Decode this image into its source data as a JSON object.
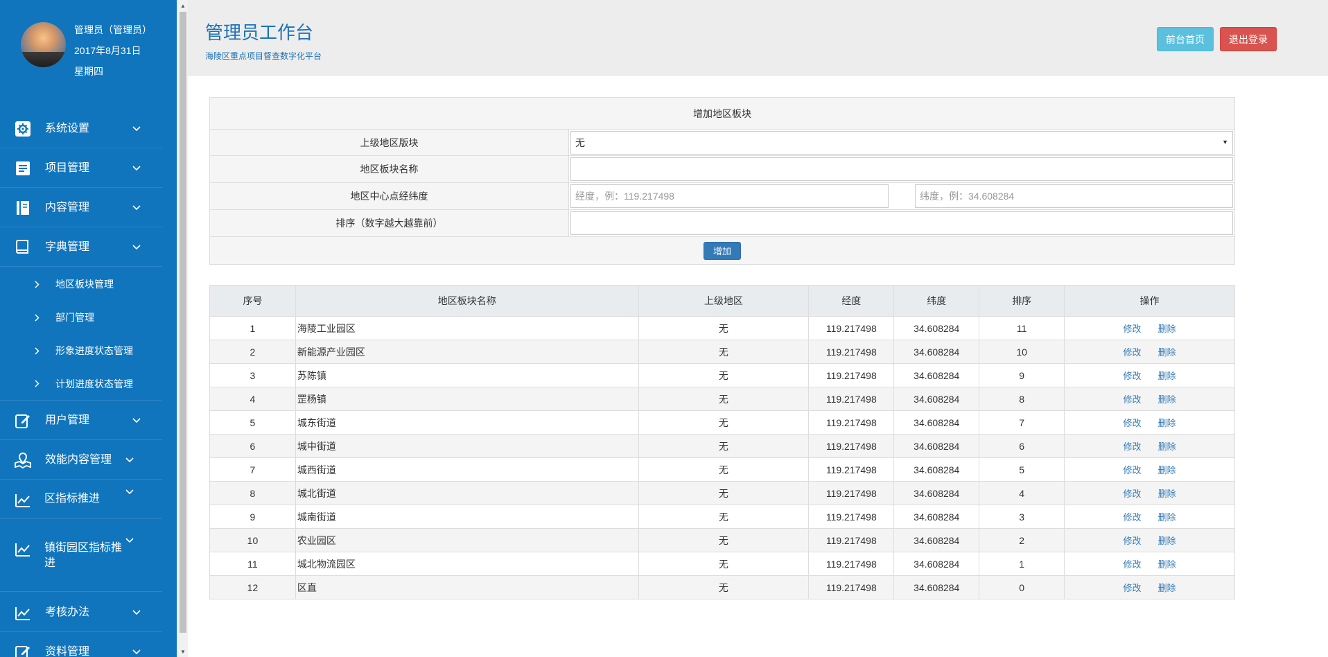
{
  "profile": {
    "name": "管理员（管理员）",
    "date": "2017年8月31日",
    "weekday": "星期四"
  },
  "nav": {
    "system": "系统设置",
    "project": "项目管理",
    "content": "内容管理",
    "dict": "字典管理",
    "dict_sub": [
      "地区板块管理",
      "部门管理",
      "形象进度状态管理",
      "计划进度状态管理"
    ],
    "user": "用户管理",
    "efficiency": "效能内容管理",
    "district": "区指标推进",
    "town": "镇街园区指标推进",
    "assess": "考核办法",
    "data": "资料管理"
  },
  "header": {
    "title": "管理员工作台",
    "subtitle": "海陵区重点项目督查数字化平台",
    "btn_front": "前台首页",
    "btn_logout": "退出登录"
  },
  "form": {
    "heading": "增加地区板块",
    "parent_label": "上级地区版块",
    "parent_value": "无",
    "name_label": "地区板块名称",
    "coord_label": "地区中心点经纬度",
    "lng_placeholder": "经度，例：119.217498",
    "lat_placeholder": "纬度，例：34.608284",
    "sort_label": "排序（数字越大越靠前）",
    "add_btn": "增加"
  },
  "table": {
    "headers": [
      "序号",
      "地区板块名称",
      "上级地区",
      "经度",
      "纬度",
      "排序",
      "操作"
    ],
    "edit_label": "修改",
    "delete_label": "删除",
    "rows": [
      {
        "no": "1",
        "name": "海陵工业园区",
        "parent": "无",
        "lng": "119.217498",
        "lat": "34.608284",
        "sort": "11"
      },
      {
        "no": "2",
        "name": "新能源产业园区",
        "parent": "无",
        "lng": "119.217498",
        "lat": "34.608284",
        "sort": "10"
      },
      {
        "no": "3",
        "name": "苏陈镇",
        "parent": "无",
        "lng": "119.217498",
        "lat": "34.608284",
        "sort": "9"
      },
      {
        "no": "4",
        "name": "罡杨镇",
        "parent": "无",
        "lng": "119.217498",
        "lat": "34.608284",
        "sort": "8"
      },
      {
        "no": "5",
        "name": "城东街道",
        "parent": "无",
        "lng": "119.217498",
        "lat": "34.608284",
        "sort": "7"
      },
      {
        "no": "6",
        "name": "城中街道",
        "parent": "无",
        "lng": "119.217498",
        "lat": "34.608284",
        "sort": "6"
      },
      {
        "no": "7",
        "name": "城西街道",
        "parent": "无",
        "lng": "119.217498",
        "lat": "34.608284",
        "sort": "5"
      },
      {
        "no": "8",
        "name": "城北街道",
        "parent": "无",
        "lng": "119.217498",
        "lat": "34.608284",
        "sort": "4"
      },
      {
        "no": "9",
        "name": "城南街道",
        "parent": "无",
        "lng": "119.217498",
        "lat": "34.608284",
        "sort": "3"
      },
      {
        "no": "10",
        "name": "农业园区",
        "parent": "无",
        "lng": "119.217498",
        "lat": "34.608284",
        "sort": "2"
      },
      {
        "no": "11",
        "name": "城北物流园区",
        "parent": "无",
        "lng": "119.217498",
        "lat": "34.608284",
        "sort": "1"
      },
      {
        "no": "12",
        "name": "区直",
        "parent": "无",
        "lng": "119.217498",
        "lat": "34.608284",
        "sort": "0"
      }
    ]
  },
  "colors": {
    "sidebar": "#1075bd",
    "accent": "#1c72b8",
    "info": "#5bc0de",
    "danger": "#d9534f",
    "primary": "#337ab7"
  }
}
